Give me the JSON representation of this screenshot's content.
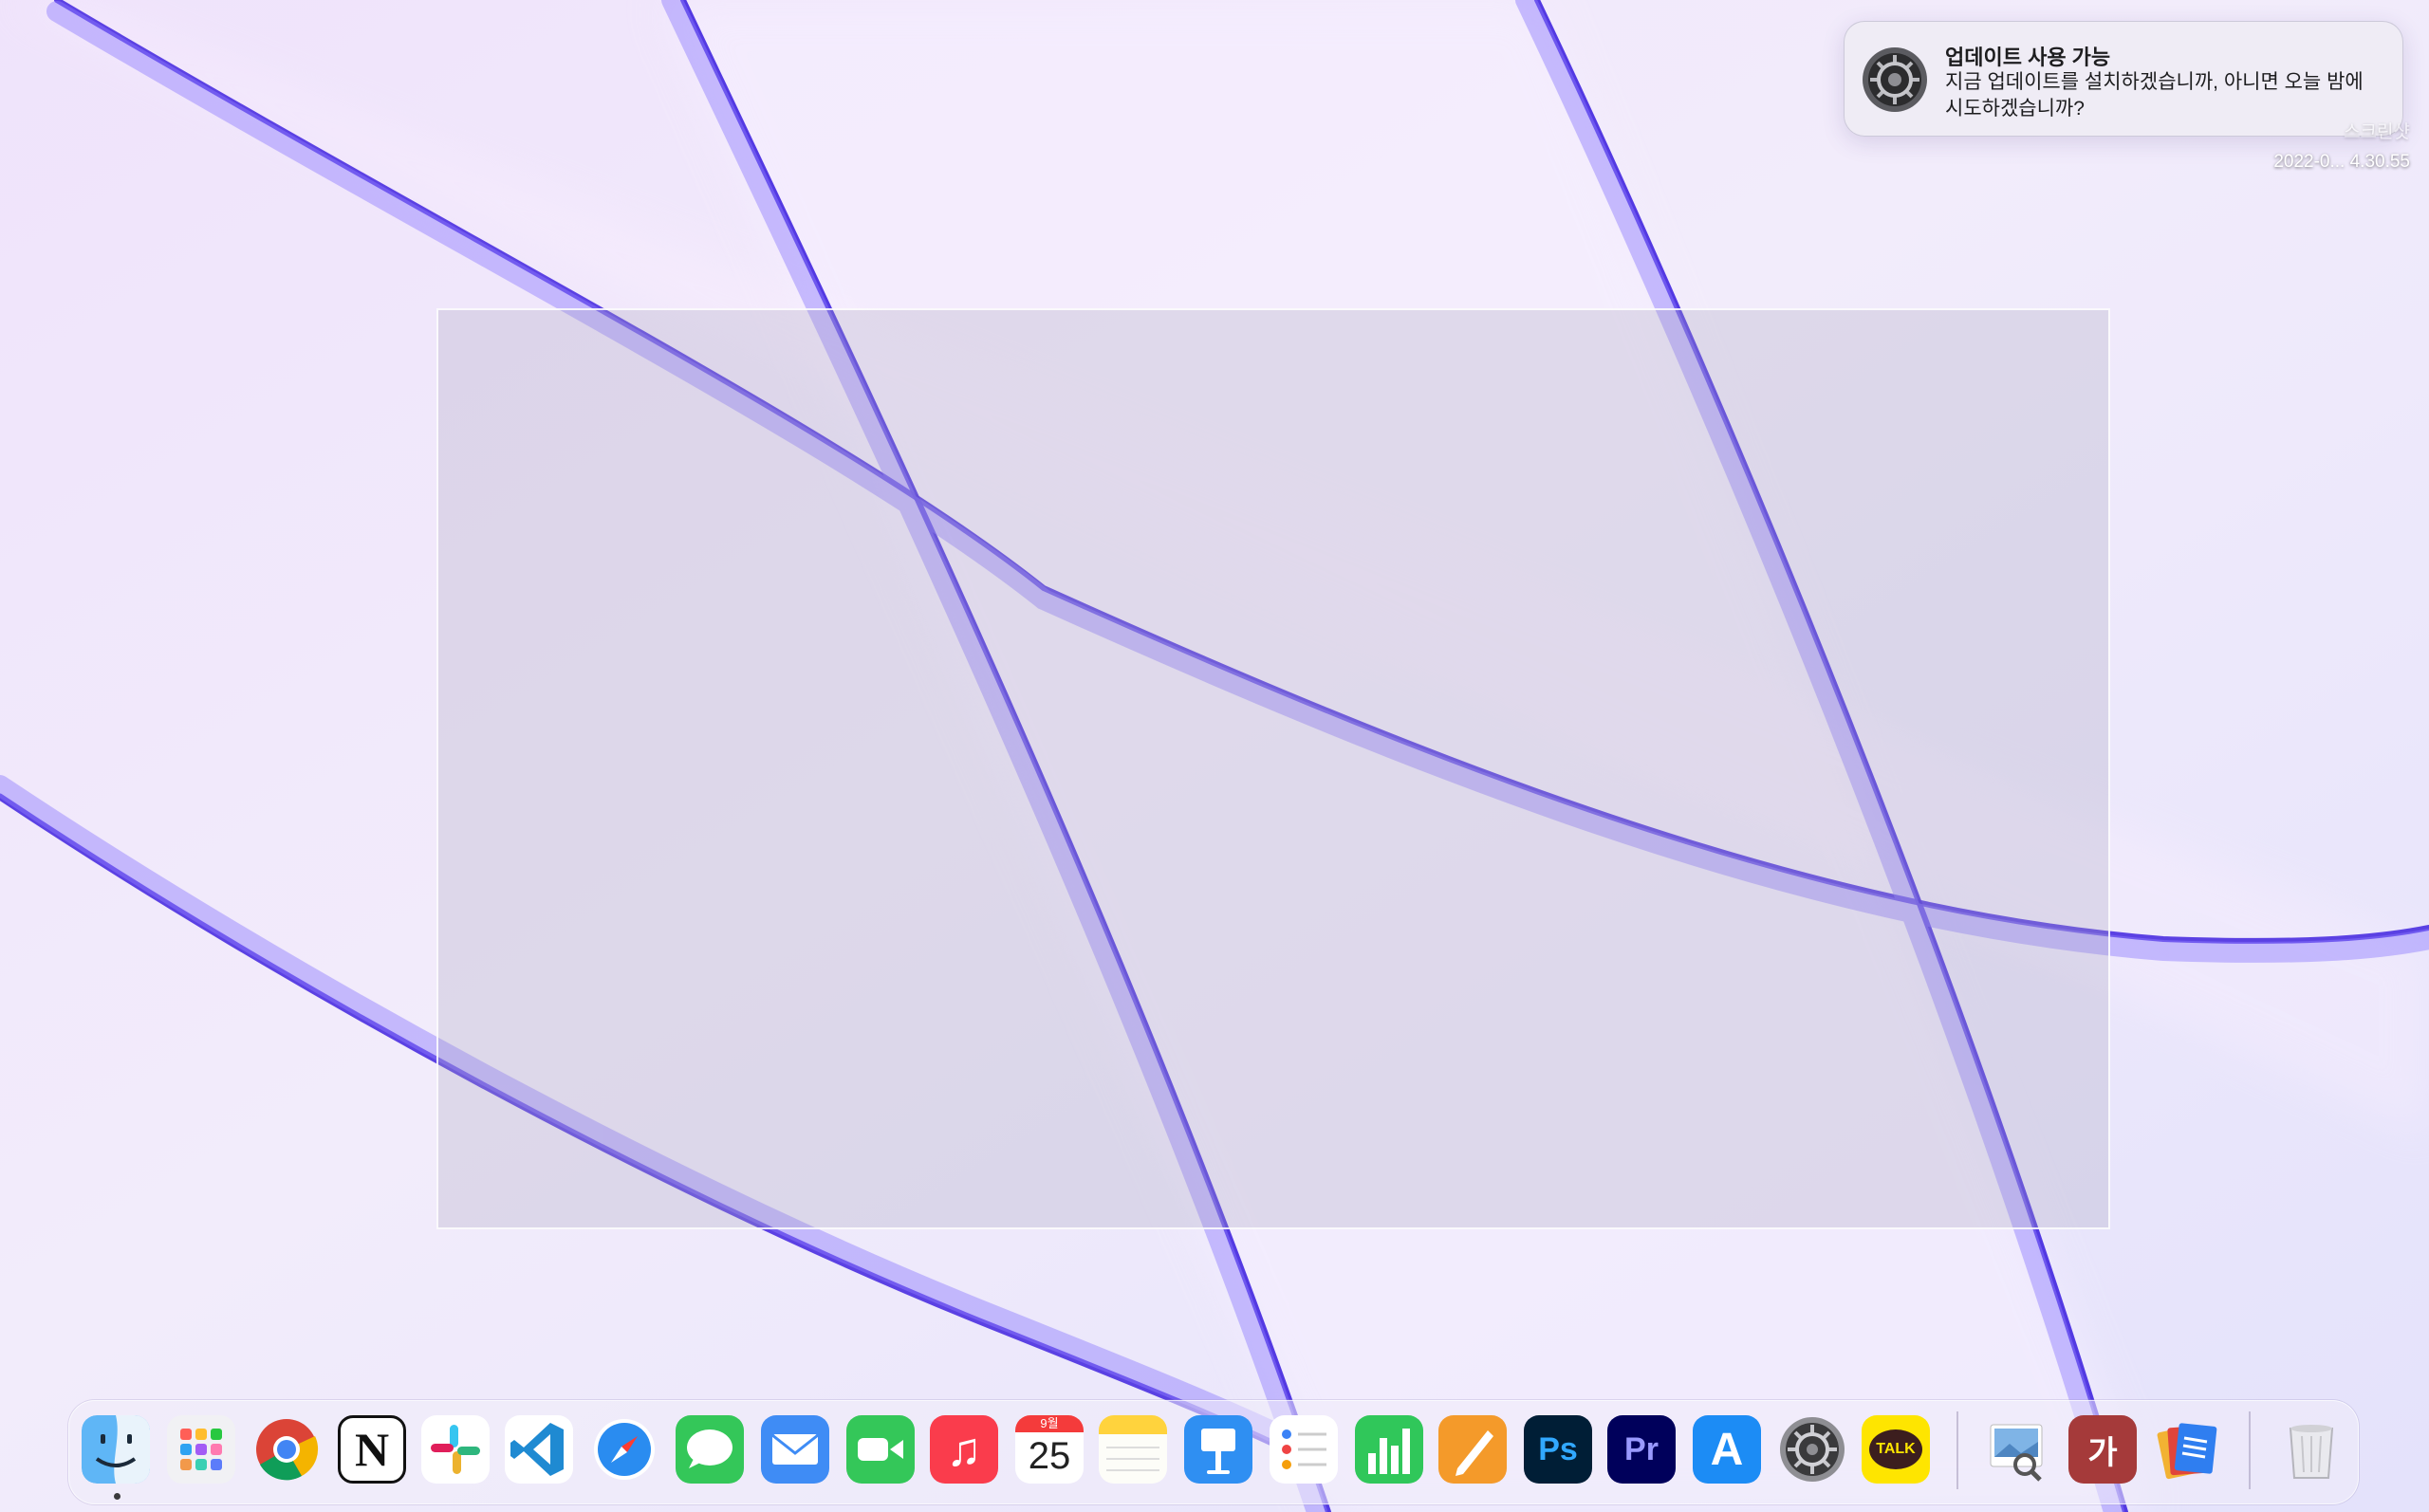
{
  "notification": {
    "app_icon": "system-preferences-gear-icon",
    "title": "업데이트 사용 가능",
    "body": "지금 업데이트를 설치하겠습니까, 아니면 오늘 밤에 시도하겠습니까?"
  },
  "screenshot_thumbnail": {
    "name": "스크린샷",
    "date": "2022-0... 4.30.55"
  },
  "dock": {
    "apps": [
      {
        "name": "Finder",
        "icon": "finder-icon",
        "running": true
      },
      {
        "name": "Launchpad",
        "icon": "launchpad-icon"
      },
      {
        "name": "Google Chrome",
        "icon": "chrome-icon"
      },
      {
        "name": "Notion",
        "icon": "notion-icon",
        "glyph": "N"
      },
      {
        "name": "Slack",
        "icon": "slack-icon"
      },
      {
        "name": "Visual Studio Code",
        "icon": "vscode-icon"
      },
      {
        "name": "Safari",
        "icon": "safari-icon"
      },
      {
        "name": "Messages",
        "icon": "messages-icon"
      },
      {
        "name": "Mail",
        "icon": "mail-icon"
      },
      {
        "name": "FaceTime",
        "icon": "facetime-icon"
      },
      {
        "name": "Music",
        "icon": "music-icon",
        "glyph": "♫"
      },
      {
        "name": "Calendar",
        "icon": "calendar-icon",
        "month": "9월",
        "day": "25"
      },
      {
        "name": "Notes",
        "icon": "notes-icon"
      },
      {
        "name": "Keynote",
        "icon": "keynote-icon"
      },
      {
        "name": "Reminders",
        "icon": "reminders-icon"
      },
      {
        "name": "Numbers",
        "icon": "numbers-icon"
      },
      {
        "name": "Pages",
        "icon": "pages-icon"
      },
      {
        "name": "Photoshop",
        "icon": "photoshop-icon",
        "glyph": "Ps"
      },
      {
        "name": "Premiere Pro",
        "icon": "premiere-icon",
        "glyph": "Pr"
      },
      {
        "name": "App Store",
        "icon": "app-store-icon",
        "glyph": "A"
      },
      {
        "name": "System Preferences",
        "icon": "system-preferences-icon"
      },
      {
        "name": "KakaoTalk",
        "icon": "kakaotalk-icon",
        "glyph": "TALK"
      },
      {
        "name": "Preview",
        "icon": "preview-icon"
      },
      {
        "name": "Dictionary",
        "icon": "dictionary-icon",
        "glyph": "가"
      },
      {
        "name": "Documents",
        "icon": "documents-stack-icon"
      },
      {
        "name": "Trash",
        "icon": "trash-icon"
      }
    ]
  },
  "colors": {
    "wallpaper_base": "#e6e0fa",
    "wallpaper_stroke": "#4a2fe0",
    "selection_border": "#ffffff"
  }
}
